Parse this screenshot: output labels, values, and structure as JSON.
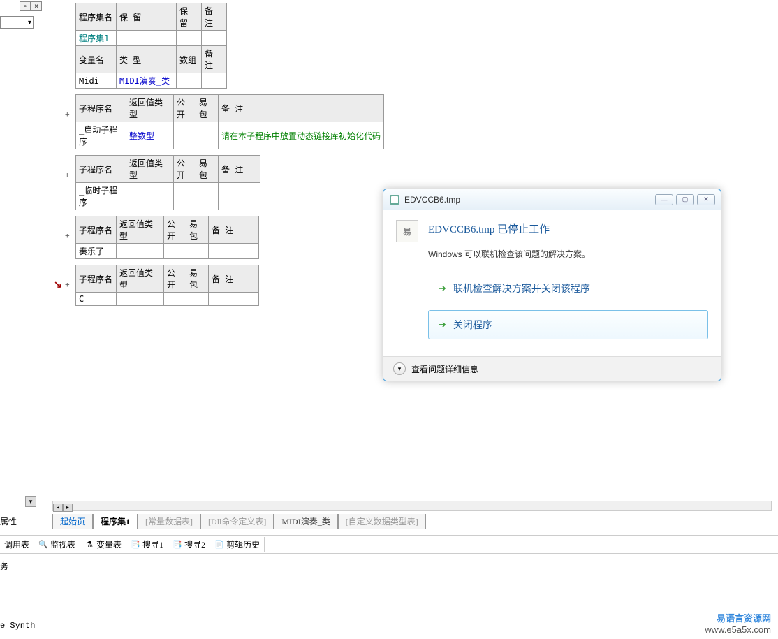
{
  "side_panel": {
    "properties_label": "属性"
  },
  "tables": {
    "program_set": {
      "headers": [
        "程序集名",
        "保 留",
        "保 留",
        "备 注"
      ],
      "row": [
        "程序集1",
        "",
        "",
        ""
      ]
    },
    "variables": {
      "headers": [
        "变量名",
        "类 型",
        "数组",
        "备 注"
      ],
      "row": [
        "Midi",
        "MIDI演奏_类",
        "",
        ""
      ]
    },
    "sub1": {
      "headers": [
        "子程序名",
        "返回值类型",
        "公开",
        "易包",
        "备 注"
      ],
      "row": [
        "_启动子程序",
        "整数型",
        "",
        "",
        "请在本子程序中放置动态链接库初始化代码"
      ]
    },
    "sub2": {
      "headers": [
        "子程序名",
        "返回值类型",
        "公开",
        "易包",
        "备 注"
      ],
      "row": [
        "_临时子程序",
        "",
        "",
        "",
        ""
      ]
    },
    "sub3": {
      "headers": [
        "子程序名",
        "返回值类型",
        "公开",
        "易包",
        "备 注"
      ],
      "row": [
        "奏乐了",
        "",
        "",
        "",
        ""
      ]
    },
    "sub4": {
      "headers": [
        "子程序名",
        "返回值类型",
        "公开",
        "易包",
        "备 注"
      ],
      "row": [
        "C",
        "",
        "",
        "",
        ""
      ]
    }
  },
  "bottom_tabs": [
    "起始页",
    "程序集1",
    "[常量数据表]",
    "[Dll命令定义表]",
    "MIDI演奏_类",
    "[自定义数据类型表]"
  ],
  "tool_tabs": [
    "调用表",
    "监视表",
    "变量表",
    "搜寻1",
    "搜寻2",
    "剪辑历史"
  ],
  "status": "务",
  "footer_synth": "e Synth",
  "watermark": {
    "cn": "易语言资源网",
    "url": "www.e5a5x.com"
  },
  "dialog": {
    "title": "EDVCCB6.tmp",
    "heading": "EDVCCB6.tmp 已停止工作",
    "message": "Windows 可以联机检查该问题的解决方案。",
    "option1": "联机检查解决方案并关闭该程序",
    "option2": "关闭程序",
    "details": "查看问题详细信息",
    "icon_char": "易"
  }
}
